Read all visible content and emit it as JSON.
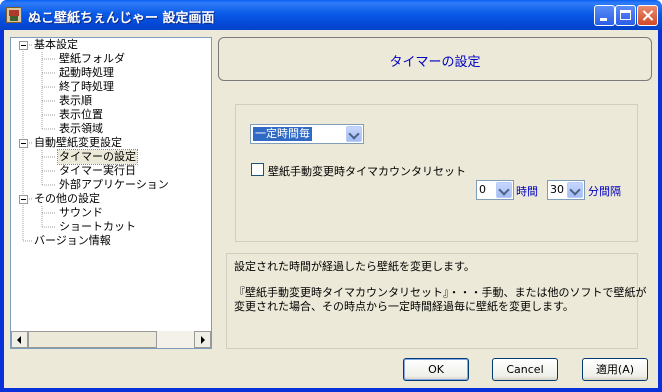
{
  "window": {
    "title": "ぬこ壁紙ちぇんじゃー 設定画面",
    "icon": "app-icon",
    "controls": [
      "minimize-icon",
      "maximize-icon",
      "close-icon"
    ]
  },
  "tree": {
    "items": [
      {
        "label": "基本設定",
        "level": 0,
        "expanded": true
      },
      {
        "label": "壁紙フォルダ",
        "level": 1
      },
      {
        "label": "起動時処理",
        "level": 1
      },
      {
        "label": "終了時処理",
        "level": 1
      },
      {
        "label": "表示順",
        "level": 1
      },
      {
        "label": "表示位置",
        "level": 1
      },
      {
        "label": "表示領域",
        "level": 1
      },
      {
        "label": "自動壁紙変更設定",
        "level": 0,
        "expanded": true
      },
      {
        "label": "タイマーの設定",
        "level": 1,
        "selected": true
      },
      {
        "label": "タイマー実行日",
        "level": 1
      },
      {
        "label": "外部アプリケーション",
        "level": 1
      },
      {
        "label": "その他の設定",
        "level": 0,
        "expanded": true
      },
      {
        "label": "サウンド",
        "level": 1
      },
      {
        "label": "ショートカット",
        "level": 1
      },
      {
        "label": "バージョン情報",
        "level": 0
      }
    ]
  },
  "header": {
    "title": "タイマーの設定"
  },
  "settings": {
    "mode_select": {
      "value": "一定時間毎"
    },
    "reset_checkbox": {
      "label": "壁紙手動変更時タイマカウンタリセット",
      "checked": false
    },
    "hours": {
      "value": "0",
      "unit": "時間"
    },
    "minutes": {
      "value": "30",
      "unit": "分間隔"
    }
  },
  "description": {
    "line1": "設定された時間が経過したら壁紙を変更します。",
    "line2": "『壁紙手動変更時タイマカウンタリセット』・・・手動、または他のソフトで壁紙が",
    "line3": "変更された場合、その時点から一定時間経過毎に壁紙を変更します。"
  },
  "buttons": {
    "ok": "OK",
    "cancel": "Cancel",
    "apply": "適用(A)"
  },
  "colors": {
    "title_bar": "#0a5be8",
    "accent_text": "#0000c0",
    "selection": "#316ac5",
    "face": "#ece9d8"
  }
}
